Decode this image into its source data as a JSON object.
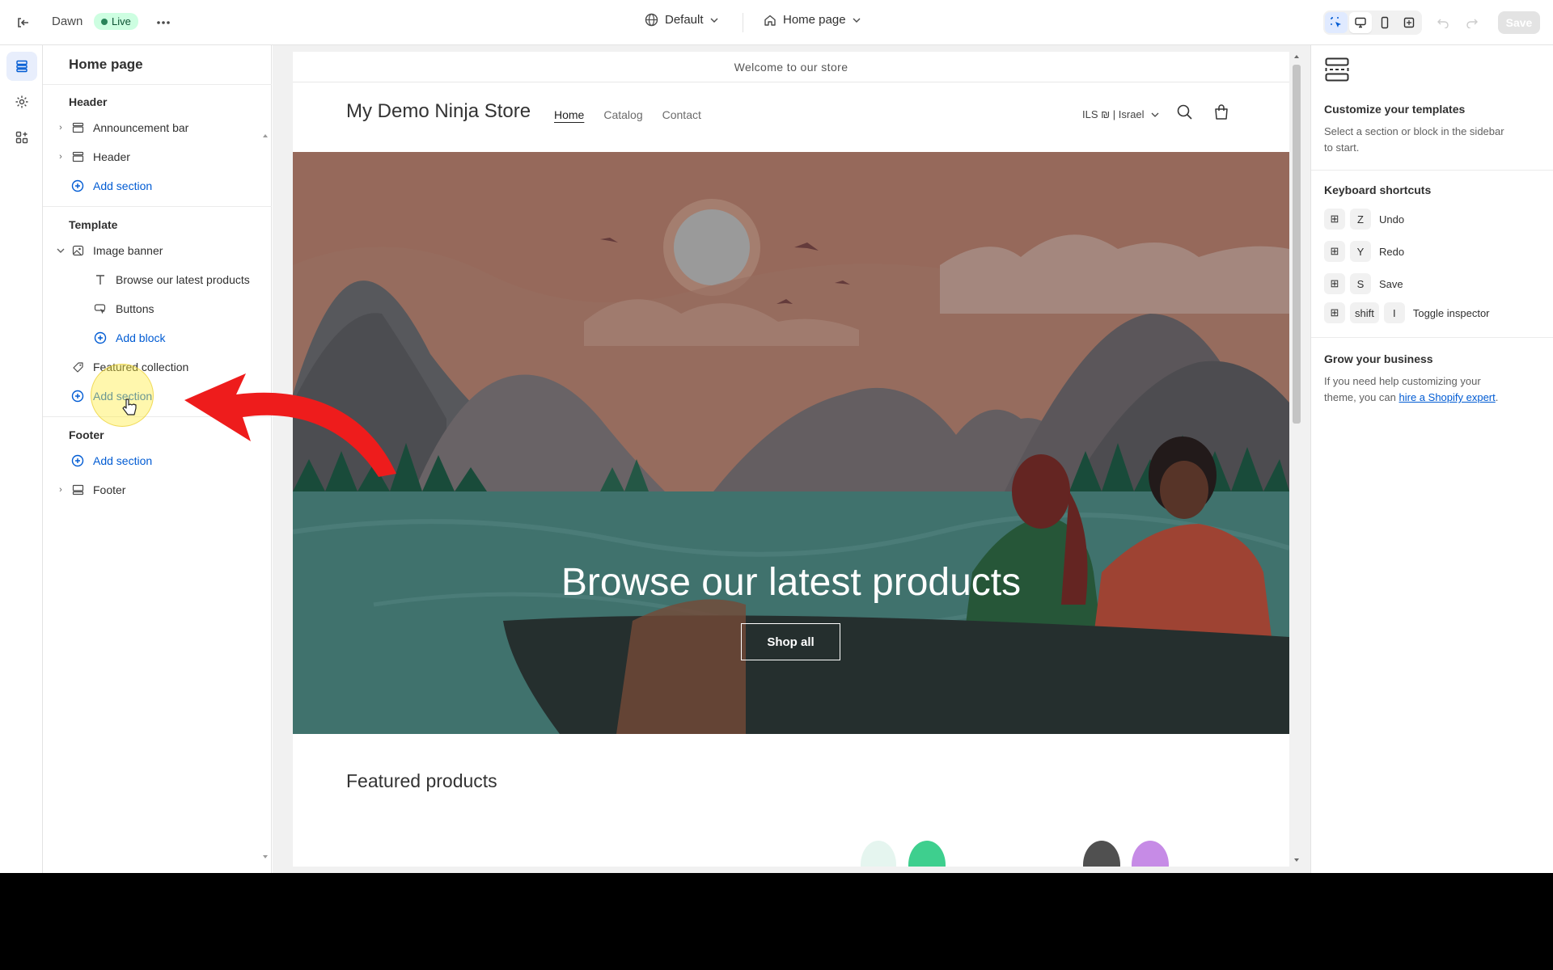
{
  "topbar": {
    "theme_name": "Dawn",
    "live_label": "Live",
    "view_selector": "Default",
    "page_selector": "Home page",
    "save_label": "Save"
  },
  "sidebar": {
    "title": "Home page",
    "header_group": "Header",
    "header_items": [
      "Announcement bar",
      "Header"
    ],
    "add_section": "Add section",
    "template_group": "Template",
    "image_banner": "Image banner",
    "banner_blocks": [
      "Browse our latest products",
      "Buttons"
    ],
    "add_block": "Add block",
    "featured_collection": "Featured collection",
    "footer_group": "Footer",
    "footer_item": "Footer"
  },
  "preview": {
    "announcement": "Welcome to our store",
    "store_name": "My Demo Ninja Store",
    "nav": [
      "Home",
      "Catalog",
      "Contact"
    ],
    "locale": "ILS ₪ | Israel",
    "banner_heading": "Browse our latest products",
    "banner_button": "Shop all",
    "featured_heading": "Featured products"
  },
  "right_panel": {
    "customize_title": "Customize your templates",
    "customize_text": "Select a section or block in the sidebar to start.",
    "shortcuts_title": "Keyboard shortcuts",
    "shortcuts": [
      {
        "keys": [
          "Z"
        ],
        "label": "Undo"
      },
      {
        "keys": [
          "Y"
        ],
        "label": "Redo"
      },
      {
        "keys": [
          "S"
        ],
        "label": "Save"
      },
      {
        "keys": [
          "shift",
          "I"
        ],
        "label": "Toggle inspector"
      }
    ],
    "grow_title": "Grow your business",
    "grow_text": "If you need help customizing your theme, you can",
    "grow_link": "hire a Shopify expert",
    "grow_end": "."
  },
  "colors": {
    "accent": "#005bd3",
    "live_bg": "#cdfee1",
    "arrow": "#ee1c1c",
    "highlight": "#ffeb3b"
  }
}
